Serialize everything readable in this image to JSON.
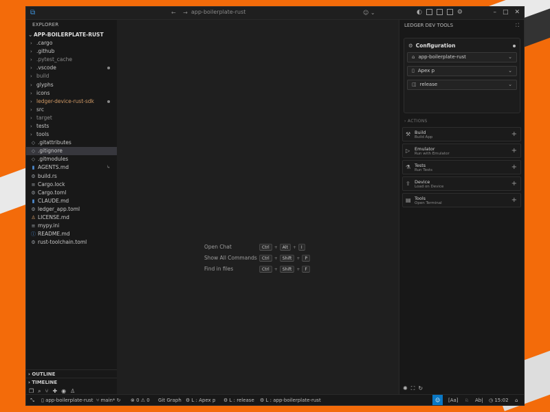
{
  "titlebar": {
    "search_text": "app-boilerplate-rust",
    "nav_back": "←",
    "nav_forward": "→"
  },
  "explorer": {
    "header": "EXPLORER",
    "root": "APP-BOILERPLATE-RUST",
    "items": [
      {
        "label": ".cargo",
        "kind": "folder"
      },
      {
        "label": ".github",
        "kind": "folder"
      },
      {
        "label": ".pytest_cache",
        "kind": "folder"
      },
      {
        "label": ".vscode",
        "kind": "folder"
      },
      {
        "label": "build",
        "kind": "folder"
      },
      {
        "label": "glyphs",
        "kind": "folder"
      },
      {
        "label": "icons",
        "kind": "folder"
      },
      {
        "label": "ledger-device-rust-sdk",
        "kind": "folder"
      },
      {
        "label": "src",
        "kind": "folder"
      },
      {
        "label": "target",
        "kind": "folder"
      },
      {
        "label": "tests",
        "kind": "folder"
      },
      {
        "label": "tools",
        "kind": "folder"
      },
      {
        "label": ".gitattributes",
        "kind": "file"
      },
      {
        "label": ".gitignore",
        "kind": "file"
      },
      {
        "label": ".gitmodules",
        "kind": "file"
      },
      {
        "label": "AGENTS.md",
        "kind": "file"
      },
      {
        "label": "build.rs",
        "kind": "file"
      },
      {
        "label": "Cargo.lock",
        "kind": "file"
      },
      {
        "label": "Cargo.toml",
        "kind": "file"
      },
      {
        "label": "CLAUDE.md",
        "kind": "file"
      },
      {
        "label": "ledger_app.toml",
        "kind": "file"
      },
      {
        "label": "LICENSE.md",
        "kind": "file"
      },
      {
        "label": "mypy.ini",
        "kind": "file"
      },
      {
        "label": "README.md",
        "kind": "file"
      },
      {
        "label": "rust-toolchain.toml",
        "kind": "file"
      }
    ],
    "outline": "OUTLINE",
    "timeline": "TIMELINE"
  },
  "editor": {
    "shortcuts": [
      {
        "name": "Open Chat",
        "keys": [
          "Ctrl",
          "Alt",
          "I"
        ]
      },
      {
        "name": "Show All Commands",
        "keys": [
          "Ctrl",
          "Shift",
          "P"
        ]
      },
      {
        "name": "Find in files",
        "keys": [
          "Ctrl",
          "Shift",
          "F"
        ]
      }
    ]
  },
  "panel": {
    "title": "LEDGER DEV TOOLS",
    "configuration": {
      "title": "Configuration",
      "app": "app-boilerplate-rust",
      "device": "Apex p",
      "profile": "release"
    },
    "actions_header": "ACTIONS",
    "actions": [
      {
        "title": "Build",
        "subtitle": "Build App"
      },
      {
        "title": "Emulator",
        "subtitle": "Run with Emulator"
      },
      {
        "title": "Tests",
        "subtitle": "Run Tests"
      },
      {
        "title": "Device",
        "subtitle": "Load on Device"
      },
      {
        "title": "Tools",
        "subtitle": "Open Terminal"
      }
    ]
  },
  "statusbar": {
    "app": "app-boilerplate-rust",
    "branch": "main*",
    "errors": "0",
    "warnings": "0",
    "git_graph": "Git Graph",
    "device": "L : Apex p",
    "profile": "L : release",
    "app_target": "L : app-boilerplate-rust",
    "aa": "[Aa]",
    "ab": "Ab|",
    "time": "15:02"
  }
}
